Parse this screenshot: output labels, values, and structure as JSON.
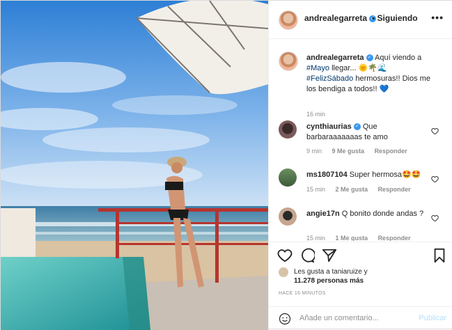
{
  "header": {
    "username": "andrealegarreta",
    "follow_status": "Siguiendo",
    "more_glyph": "•••"
  },
  "caption": {
    "username": "andrealegarreta",
    "text_before": "Aquí viendo a",
    "hashtag1": "#Mayo",
    "text_mid": "llegar... 🌞🌴🌊",
    "hashtag2": "#FelizSábado",
    "text_after": "hermosuras!! Dios me los bendiga a todos!! 💙",
    "time": "16 min"
  },
  "comments": [
    {
      "username": "cynthiaurias",
      "verified": true,
      "text": "Que barbaraaaaaaas te amo",
      "time": "9 min",
      "likes": "9 Me gusta",
      "reply": "Responder"
    },
    {
      "username": "ms1807104",
      "verified": false,
      "text": "Super hermosa🤩🤩",
      "time": "15 min",
      "likes": "2 Me gusta",
      "reply": "Responder"
    },
    {
      "username": "angie17n",
      "verified": false,
      "text": "Q bonito donde andas ?",
      "time": "15 min",
      "likes": "1 Me gusta",
      "reply": "Responder"
    }
  ],
  "likes": {
    "line1": "Les gusta a taniaruize y",
    "line2": "11.278 personas más"
  },
  "post_time": "HACE 16 MINUTOS",
  "comment_box": {
    "placeholder": "Añade un comentario...",
    "publish_label": "Publicar"
  },
  "colors": {
    "verified": "#3897f0",
    "hashtag": "#00376b",
    "publish_disabled": "#b2dffc",
    "muted": "#8e8e8e"
  }
}
